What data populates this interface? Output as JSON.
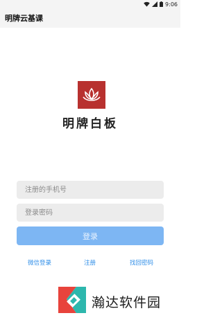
{
  "status_bar": {
    "time": "9:06",
    "icons": [
      "wifi-icon",
      "signal-icon",
      "battery-icon"
    ]
  },
  "app_bar": {
    "title": "明牌云基课"
  },
  "branding": {
    "logo": "lotus-logo-icon",
    "name": "明牌白板",
    "accent_color": "#b8312f"
  },
  "form": {
    "phone_placeholder": "注册的手机号",
    "phone_value": "",
    "password_placeholder": "登录密码",
    "password_value": "",
    "login_label": "登录",
    "login_color": "#7db6f3"
  },
  "links": {
    "wechat_login": "微信登录",
    "register": "注册",
    "forgot_password": "找回密码",
    "link_color": "#2f8ee8"
  },
  "watermark": {
    "text": "瀚达软件园",
    "logo": "watermark-logo-icon"
  }
}
